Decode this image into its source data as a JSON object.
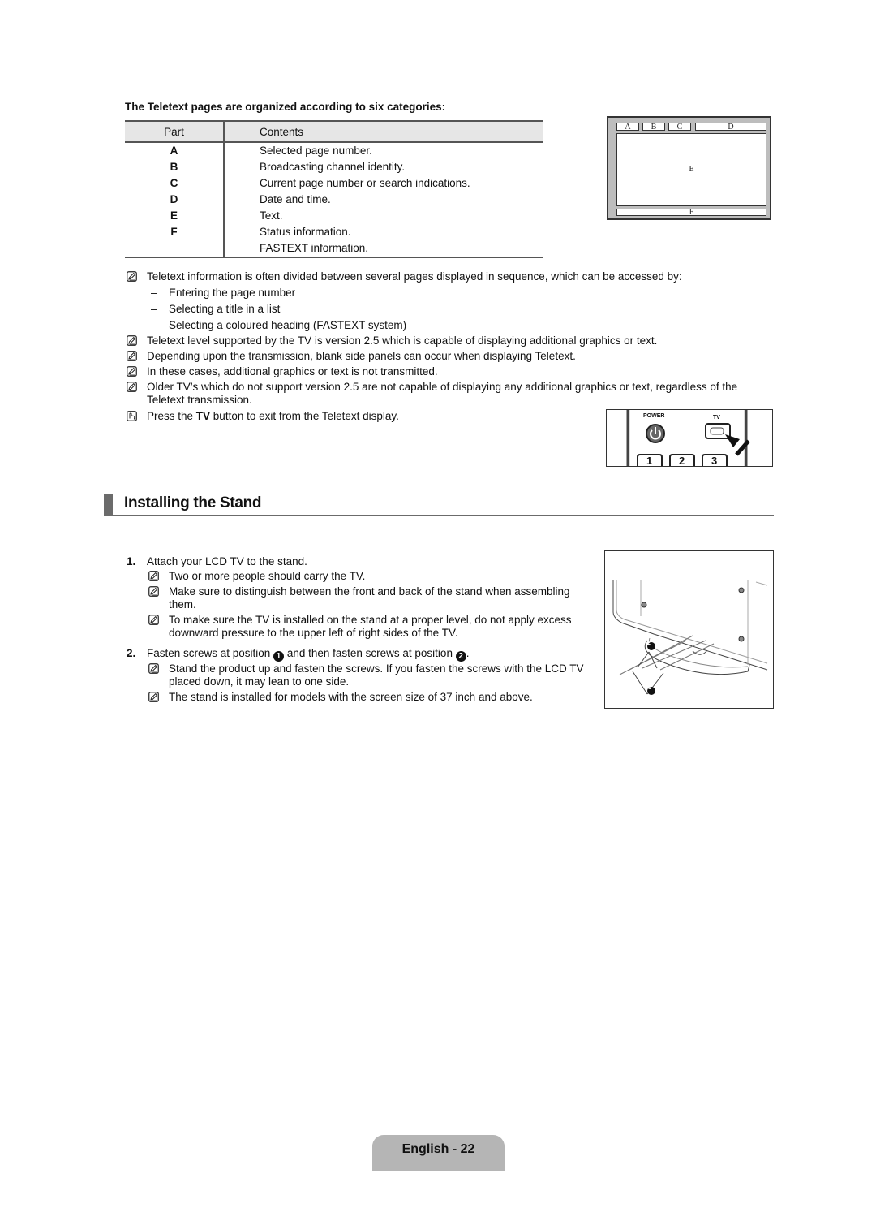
{
  "teletext": {
    "intro": "The Teletext pages are organized according to six categories:",
    "table": {
      "headers": [
        "Part",
        "Contents"
      ],
      "rows": [
        {
          "part": "A",
          "contents": "Selected page number."
        },
        {
          "part": "B",
          "contents": "Broadcasting channel identity."
        },
        {
          "part": "C",
          "contents": "Current page number or search indications."
        },
        {
          "part": "D",
          "contents": "Date and time."
        },
        {
          "part": "E",
          "contents": "Text."
        },
        {
          "part": "F",
          "contents": "Status information."
        },
        {
          "part": "",
          "contents": "FASTEXT information."
        }
      ]
    },
    "diagram": {
      "labels": {
        "a": "A",
        "b": "B",
        "c": "C",
        "d": "D",
        "e": "E",
        "f": "F"
      }
    },
    "notes": [
      {
        "icon": "note-icon",
        "text": "Teletext information is often divided between several pages displayed in sequence, which can be accessed by:"
      },
      {
        "icon": "note-icon",
        "text": "Teletext level supported by the TV is version 2.5 which is capable of displaying additional graphics or text."
      },
      {
        "icon": "note-icon",
        "text": "Depending upon the transmission, blank side panels can occur when displaying Teletext."
      },
      {
        "icon": "note-icon",
        "text": "In these cases, additional graphics or text is not transmitted."
      },
      {
        "icon": "note-icon",
        "text": "Older TV’s which do not support version 2.5 are not capable of displaying any additional graphics or text, regardless of the Teletext transmission."
      }
    ],
    "access_methods": [
      "Entering the page number",
      "Selecting a title in a list",
      "Selecting a coloured heading (FASTEXT system)"
    ],
    "dash": "–",
    "press_note": {
      "icon": "press-button-icon",
      "before": "Press the ",
      "bold": "TV",
      "after": " button to exit from the Teletext display."
    },
    "remote": {
      "power_label": "POWER",
      "tv_label": "TV",
      "keys": [
        "1",
        "2",
        "3"
      ]
    }
  },
  "stand": {
    "title": "Installing the Stand",
    "steps": [
      {
        "num": "1.",
        "text": "Attach your LCD TV to the stand.",
        "notes": [
          "Two or more people should carry the TV.",
          "Make sure to distinguish between the front and back of the stand when assembling them.",
          "To make sure the TV is installed on the stand at a proper level, do not apply excess downward pressure to the upper left of right sides of the TV."
        ]
      },
      {
        "num": "2.",
        "text_parts": [
          "Fasten screws at position ",
          "1",
          " and then fasten screws at position ",
          "2",
          "."
        ],
        "notes": [
          "Stand the product up and fasten the screws. If you fasten the screws with the LCD TV placed down, it may lean to one side.",
          "The stand is installed for models with the screen size of 37 inch and above."
        ]
      }
    ],
    "image_callouts": [
      "1",
      "2"
    ]
  },
  "footer": {
    "page_label": "English - 22"
  }
}
